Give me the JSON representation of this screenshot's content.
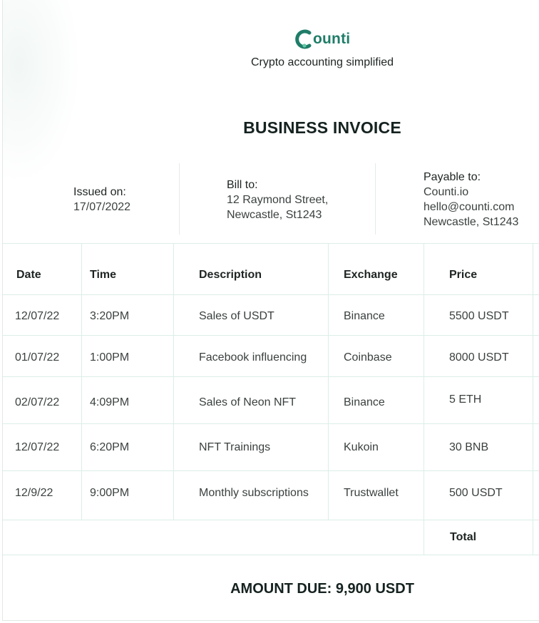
{
  "brand": {
    "logo_text": "ounti",
    "logo_mark": "C",
    "tagline": "Crypto accounting simplified",
    "color": "#1f7d68",
    "accent": "#63c7a6"
  },
  "document": {
    "title": "BUSINESS INVOICE"
  },
  "issued": {
    "label": "Issued on:",
    "date": "17/07/2022"
  },
  "bill_to": {
    "label": "Bill to:",
    "line1": "12 Raymond Street,",
    "line2": "Newcastle, St1243"
  },
  "payable_to": {
    "label": "Payable to:",
    "line1": "Counti.io",
    "line2": "hello@counti.com",
    "line3": "Newcastle, St1243"
  },
  "table": {
    "headers": [
      "Date",
      "Time",
      "Description",
      "Exchange",
      "Price"
    ],
    "rows": [
      [
        "12/07/22",
        "3:20PM",
        "Sales of USDT",
        "Binance",
        "5500 USDT"
      ],
      [
        "01/07/22",
        "1:00PM",
        "Facebook influencing",
        "Coinbase",
        "8000 USDT"
      ],
      [
        "02/07/22",
        "4:09PM",
        "Sales of Neon NFT",
        "Binance",
        "5 ETH"
      ],
      [
        "12/07/22",
        "6:20PM",
        "NFT Trainings",
        "Kukoin",
        "30 BNB"
      ],
      [
        "12/9/22",
        "9:00PM",
        "Monthly subscriptions",
        "Trustwallet",
        "500 USDT"
      ]
    ],
    "total_label": "Total"
  },
  "amount_due": "AMOUNT DUE: 9,900 USDT"
}
